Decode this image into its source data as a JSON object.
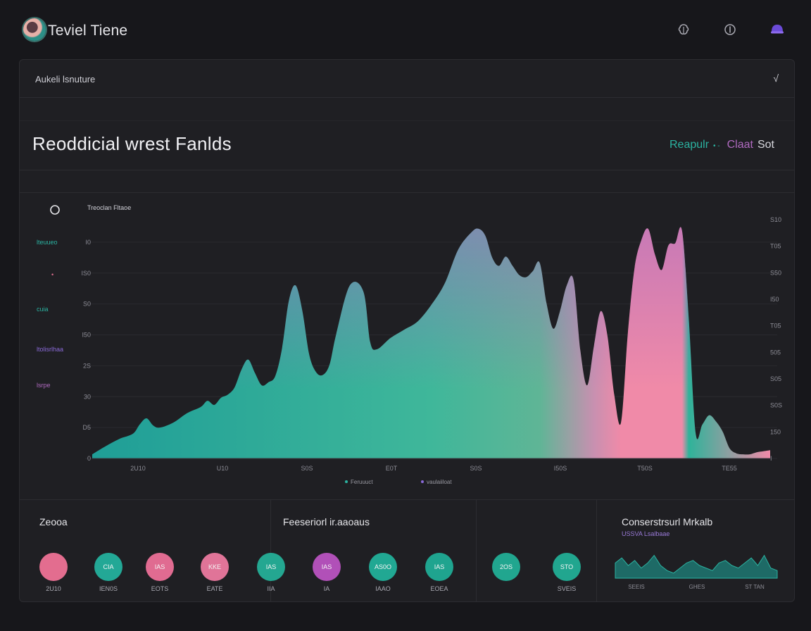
{
  "app": {
    "title": "Teviel Tiene"
  },
  "header_icons": [
    "brain-icon",
    "info-icon",
    "profile-icon"
  ],
  "card": {
    "row_label": "Aukeli lsnuture",
    "chevron": "√",
    "panel_title": "Reoddicial wrest Fanlds",
    "actions": {
      "primary": "Reapulr",
      "dot": "• -",
      "secondary": "Claat",
      "tertiary": "Sot"
    }
  },
  "left_legend": [
    {
      "label": "lteuueo",
      "color": "#2bb3a1"
    },
    {
      "label": "•",
      "color": "#e07090"
    },
    {
      "label": "cuia",
      "color": "#2bb3a1"
    },
    {
      "label": "ltolisrlhaa",
      "color": "#8a6ad8"
    },
    {
      "label": "lsrpe",
      "color": "#b06ac0"
    }
  ],
  "chart_data": {
    "type": "area",
    "title": "Treoclan Fltaoe",
    "x_tick_labels": [
      "2U10",
      "U10",
      "S0S",
      "E0T",
      "S0S",
      "I50S",
      "T50S",
      "TE55"
    ],
    "y_left_ticks": [
      "0",
      "D5",
      "30",
      "2S",
      "I50",
      "S0",
      "IS0",
      "I0"
    ],
    "y_right_ticks": [
      "I",
      "150",
      "S0S",
      "S05",
      "505",
      "T05",
      "I50",
      "S50",
      "T05",
      "S10"
    ],
    "legend": [
      "Feruuuct",
      "vaulaiiloat"
    ],
    "series": [
      {
        "x": [
          0,
          2,
          4,
          6,
          7,
          8,
          9,
          10,
          12,
          14,
          16,
          17,
          18,
          19,
          20,
          21,
          22,
          23,
          24,
          25,
          26,
          27,
          28,
          29,
          30,
          31,
          32,
          33,
          34,
          35,
          36,
          38,
          40,
          41,
          42,
          44,
          46,
          48,
          50,
          52,
          54,
          56,
          57,
          58,
          59,
          60,
          61,
          62,
          63,
          64,
          65,
          66,
          67,
          68,
          69,
          70,
          71,
          72,
          73,
          74,
          75,
          76,
          77,
          78,
          79,
          80,
          81,
          82,
          83,
          84,
          85,
          86,
          87,
          88,
          89,
          90,
          91,
          92,
          93,
          94,
          95,
          96,
          97,
          98,
          99,
          100
        ],
        "values": [
          0.4,
          1.2,
          1.9,
          2.4,
          3.3,
          3.9,
          3.2,
          3.0,
          3.5,
          4.4,
          5.0,
          5.6,
          5.2,
          5.9,
          6.2,
          6.9,
          8.6,
          9.6,
          8.3,
          7.1,
          7.4,
          8.0,
          10.7,
          15.3,
          16.8,
          14.3,
          10.1,
          8.4,
          8.1,
          9.1,
          12.1,
          16.8,
          16.2,
          11.3,
          10.6,
          11.7,
          12.5,
          13.3,
          14.9,
          17.0,
          20.3,
          22.0,
          22.3,
          21.6,
          19.5,
          18.7,
          19.6,
          18.7,
          17.8,
          17.6,
          18.2,
          19.0,
          15.1,
          12.6,
          14.3,
          16.8,
          17.3,
          10.5,
          7.1,
          10.9,
          14.3,
          11.9,
          6.2,
          3.5,
          12.1,
          18.5,
          21.2,
          22.3,
          19.8,
          18.3,
          20.7,
          20.9,
          22.1,
          13.5,
          2.5,
          3.3,
          4.2,
          3.6,
          2.6,
          1.0,
          0.5,
          0.4,
          0.4,
          0.6,
          0.7,
          0.8
        ]
      }
    ],
    "ylim": [
      0,
      24
    ],
    "xlim": [
      0,
      100
    ],
    "grid": true,
    "colors": {
      "teal": "#1f9e97",
      "mint": "#3fb79a",
      "purple": "#a66cc2",
      "pink": "#f08aa8"
    }
  },
  "bottom": {
    "sections": [
      {
        "title": "Zeooa"
      },
      {
        "title": "Feeseriorl ir.aaoaus"
      },
      {
        "title": ""
      },
      {
        "title": "Conserstrsurl Mrkalb",
        "subtitle": "USSVA Lsalbaae"
      }
    ],
    "kpis": [
      {
        "value": "",
        "label": "2U10",
        "color": "#e36d8f"
      },
      {
        "value": "CIA",
        "label": "IEN0S",
        "color": "#23a896"
      },
      {
        "value": "IAS",
        "label": "EOTS",
        "color": "#e06b91"
      },
      {
        "value": "KKE",
        "label": "EATE",
        "color": "#e07498"
      },
      {
        "value": "IAS",
        "label": "IIA",
        "color": "#24a791"
      },
      {
        "value": "IAS",
        "label": "IA",
        "color": "#b150b8"
      },
      {
        "value": "AS0O",
        "label": "IAAO",
        "color": "#21a893"
      },
      {
        "value": "IAS",
        "label": "EOEA",
        "color": "#1fa48f"
      },
      {
        "value": "2OS",
        "label": "",
        "color": "#21a68f"
      },
      {
        "value": "STO",
        "label": "SVEIS",
        "color": "#21a68f"
      }
    ],
    "mini_chart_labels": [
      "SEEIS",
      "GHES",
      "ST TAN"
    ]
  }
}
